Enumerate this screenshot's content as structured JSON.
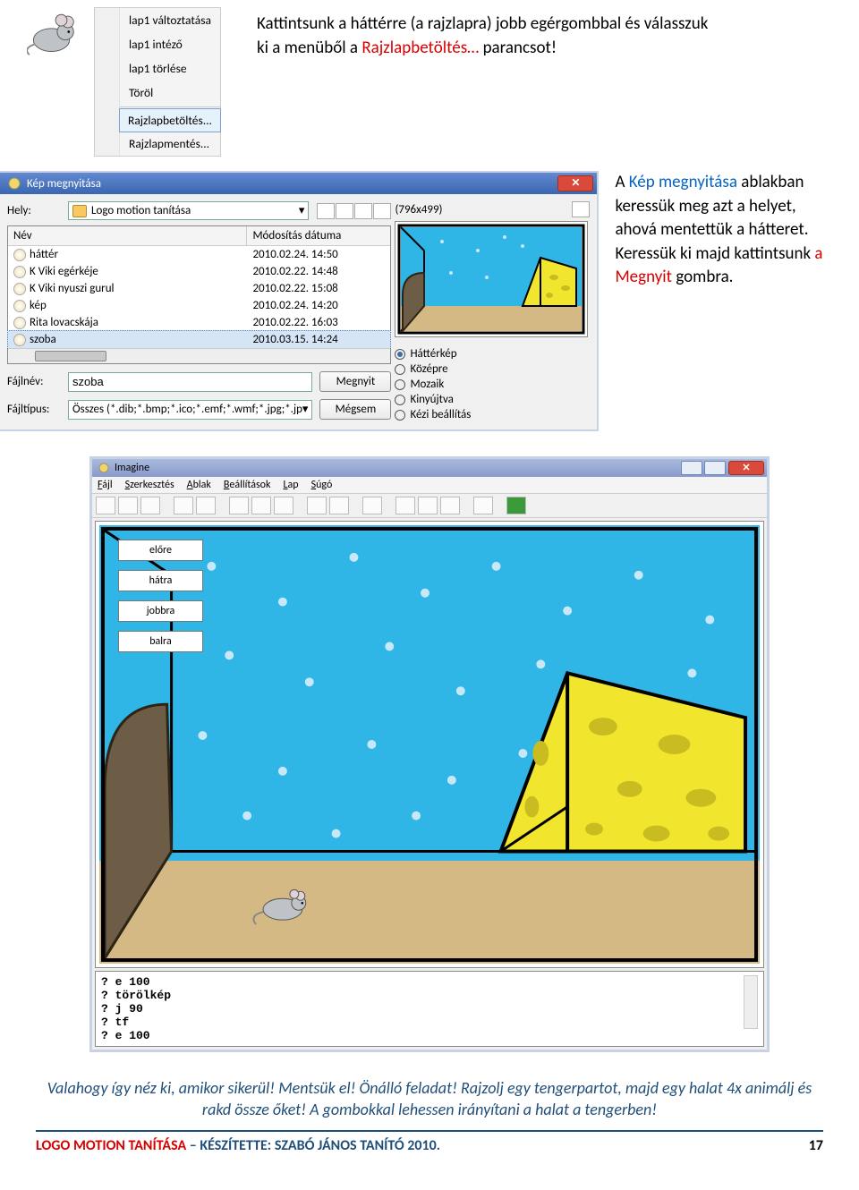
{
  "top": {
    "text_before": "Kattintsunk a háttérre (a rajzlapra) jobb egérgombbal és válasszuk ki a menüből a ",
    "highlight": "Rajzlapbetöltés…",
    "text_after": " parancsot!",
    "ctx": {
      "i1": "lap1 változtatása",
      "i2": "lap1 intéző",
      "i3": "lap1 törlése",
      "i4": "Töröl",
      "i5": "Rajzlapbetöltés...",
      "i6": "Rajzlapmentés..."
    }
  },
  "dlg": {
    "title": "Kép megnyitása",
    "loc_label": "Hely:",
    "loc_value": "Logo motion tanítása",
    "col_name": "Név",
    "col_date": "Módosítás dátuma",
    "files": [
      {
        "n": "háttér",
        "d": "2010.02.24. 14:50"
      },
      {
        "n": "K Viki egérkéje",
        "d": "2010.02.22. 14:48"
      },
      {
        "n": "K Viki nyuszi gurul",
        "d": "2010.02.22. 15:08"
      },
      {
        "n": "kép",
        "d": "2010.02.24. 14:20"
      },
      {
        "n": "Rita lovacskája",
        "d": "2010.02.22. 16:03"
      },
      {
        "n": "szoba",
        "d": "2010.03.15. 14:24"
      }
    ],
    "fn_label": "Fájlnév:",
    "fn_value": "szoba",
    "ft_label": "Fájltípus:",
    "ft_value": "Összes (*.dib;*.bmp;*.ico;*.emf;*.wmf;*.jpg;*.jp",
    "btn_open": "Megnyit",
    "btn_cancel": "Mégsem",
    "dims": "(796x499)",
    "radios": {
      "r1": "Háttérkép",
      "r2": "Középre",
      "r3": "Mozaik",
      "r4": "Kinyújtva",
      "r5": "Kézi beállítás"
    }
  },
  "side": {
    "t1": "A ",
    "t2": "Kép megnyitása",
    "t3": " ablakban keressük meg azt a helyet, ahová mentettük a hátteret. Keressük ki majd kattintsunk ",
    "t4": "a Megnyit",
    "t5": " gombra."
  },
  "imagine": {
    "title": "Imagine",
    "menu": {
      "m1": "Fájl",
      "m2": "Szerkesztés",
      "m3": "Ablak",
      "m4": "Beállítások",
      "m5": "Lap",
      "m6": "Súgó"
    },
    "btns": {
      "b1": "előre",
      "b2": "hátra",
      "b3": "jobbra",
      "b4": "balra"
    },
    "console": {
      "l1": "? e 100",
      "l2": "? törölkép",
      "l3": "? j 90",
      "l4": "? tf",
      "l5": "? e 100"
    }
  },
  "bottom": {
    "text": "Valahogy így néz ki, amikor sikerül! Mentsük el! Önálló feladat! Rajzolj egy tengerpartot, majd egy halat 4x animálj és rakd össze őket! A gombokkal lehessen irányítani a halat a tengerben!"
  },
  "footer": {
    "left1": "LOGO MOTION TANÍTÁSA",
    "sep": " – ",
    "left2": "KÉSZÍTETTE: SZABÓ JÁNOS TANÍTÓ 2010.",
    "page": "17"
  }
}
